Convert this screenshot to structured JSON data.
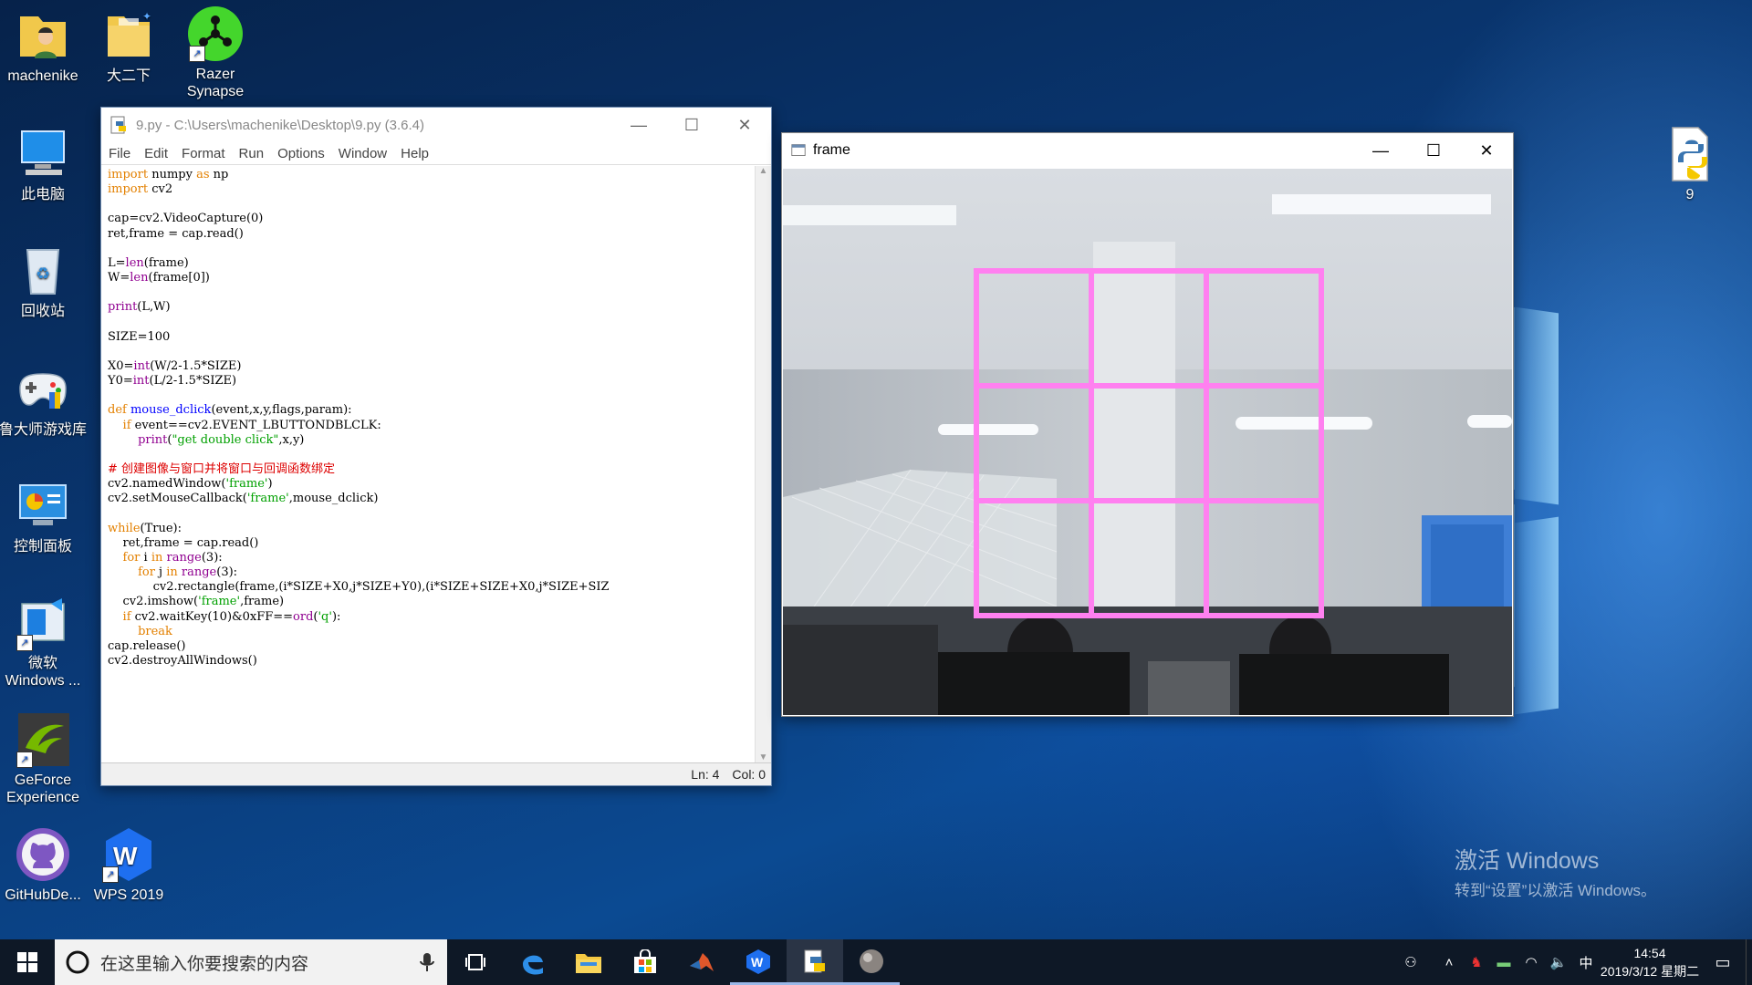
{
  "desktop": {
    "icons": [
      {
        "label": "machenike",
        "icon": "user-folder-icon"
      },
      {
        "label": "大二下",
        "icon": "folder-icon"
      },
      {
        "label": "Razer\nSynapse",
        "icon": "razer-synapse-icon"
      },
      {
        "label": "此电脑",
        "icon": "computer-icon"
      },
      {
        "label": "回收站",
        "icon": "recycle-bin-icon"
      },
      {
        "label": "鲁大师游戏库",
        "icon": "gamepad-icon"
      },
      {
        "label": "控制面板",
        "icon": "control-panel-icon"
      },
      {
        "label": "微软\nWindows ...",
        "icon": "windows-installer-icon"
      },
      {
        "label": "GeForce\nExperience",
        "icon": "geforce-icon"
      },
      {
        "label": "GitHubDe...",
        "icon": "github-desktop-icon"
      },
      {
        "label": "WPS 2019",
        "icon": "wps-icon"
      },
      {
        "label": "9",
        "icon": "python-file-icon"
      }
    ],
    "watermark": {
      "title": "激活 Windows",
      "subtitle": "转到“设置”以激活 Windows。"
    }
  },
  "idle_window": {
    "title": "9.py - C:\\Users\\machenike\\Desktop\\9.py (3.6.4)",
    "menu": [
      "File",
      "Edit",
      "Format",
      "Run",
      "Options",
      "Window",
      "Help"
    ],
    "status": {
      "line": "Ln: 4",
      "col": "Col: 0"
    }
  },
  "code_lines": [
    "import numpy as np",
    "import cv2",
    "",
    "cap=cv2.VideoCapture(0)",
    "ret,frame = cap.read()",
    "",
    "L=len(frame)",
    "W=len(frame[0])",
    "",
    "print(L,W)",
    "",
    "SIZE=100",
    "",
    "X0=int(W/2-1.5*SIZE)",
    "Y0=int(L/2-1.5*SIZE)",
    "",
    "def mouse_dclick(event,x,y,flags,param):",
    "    if event==cv2.EVENT_LBUTTONDBLCLK:",
    "        print(\"get double click\",x,y)",
    "",
    "# 创建图像与窗口并将窗口与回调函数绑定",
    "cv2.namedWindow('frame')",
    "cv2.setMouseCallback('frame',mouse_dclick)",
    "",
    "while(True):",
    "    ret,frame = cap.read()",
    "    for i in range(3):",
    "        for j in range(3):",
    "            cv2.rectangle(frame,(i*SIZE+X0,j*SIZE+Y0),(i*SIZE+SIZE+X0,j*SIZE+SIZ",
    "    cv2.imshow('frame',frame)",
    "    if cv2.waitKey(10)&0xFF==ord('q'):",
    "        break",
    "cap.release()",
    "cv2.destroyAllWindows()"
  ],
  "frame_window": {
    "title": "frame",
    "grid_color": "#ff80f0",
    "grid_rows": 3,
    "grid_cols": 3
  },
  "taskbar": {
    "search_placeholder": "在这里输入你要搜索的内容",
    "apps": [
      "task-view-icon",
      "edge-icon",
      "file-explorer-icon",
      "store-icon",
      "matlab-icon",
      "wps-icon",
      "python-idle-icon",
      "app-ball-icon"
    ],
    "ime": "中",
    "time": "14:54",
    "date": "2019/3/12 星期二"
  },
  "colors": {
    "accent": "#0078d7",
    "keyword": "#e38000",
    "builtin": "#900090",
    "string": "#00a000",
    "comment": "#dd0000",
    "defname": "#0000ff"
  }
}
